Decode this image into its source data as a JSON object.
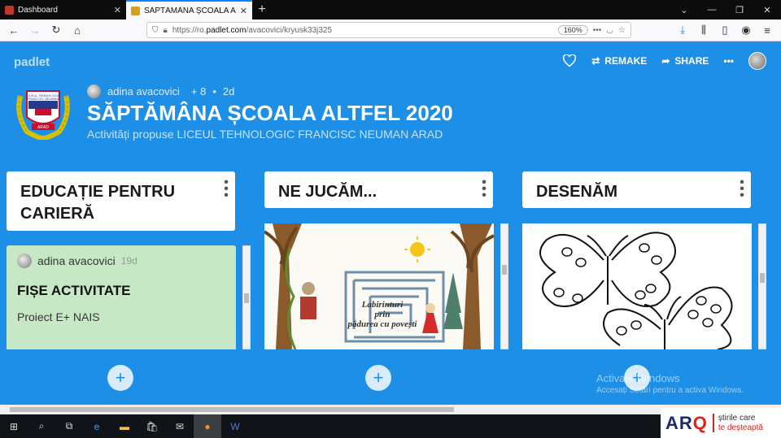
{
  "browser": {
    "tabs": [
      {
        "title": "Dashboard",
        "active": false
      },
      {
        "title": "SĂPTĂMÂNA ȘCOALA ALTFEL",
        "active": true
      }
    ],
    "url_prefix": "https://ro.",
    "url_host": "padlet.com",
    "url_path": "/avacovici/kryusk33j325",
    "zoom": "160%"
  },
  "header": {
    "logo": "padlet",
    "remake": "REMAKE",
    "share": "SHARE",
    "more": "•••"
  },
  "board": {
    "author": "adina avacovici",
    "contributors": "+ 8",
    "dot": "•",
    "age": "2d",
    "title": "SĂPTĂMÂNA ȘCOALA ALTFEL 2020",
    "subtitle": "Activități propuse LICEUL TEHNOLOGIC FRANCISC NEUMAN ARAD",
    "badge_text_1": "LICEUL TEHNOLOGIC",
    "badge_text_2": "FRANCISC NEUMAN",
    "badge_text_3": "ARAD"
  },
  "columns": [
    {
      "title": "EDUCAȚIE PENTRU CARIERĂ"
    },
    {
      "title": "NE JUCĂM..."
    },
    {
      "title": "DESENĂM"
    }
  ],
  "post": {
    "author": "adina avacovici",
    "age": "19d",
    "heading": "FIȘE ACTIVITATE",
    "body": "Proiect E+ NAIS"
  },
  "maze_card": {
    "line1": "Labirinturi",
    "line2": "prin",
    "line3": "pădurea cu povești"
  },
  "watermark": {
    "title": "Activate Windows",
    "body": "Accesați Setări pentru a activa Windows."
  },
  "arq": {
    "logo_a": "AR",
    "logo_b": "Q",
    "tag1": "știrile care",
    "tag2": "te deșteaptă"
  },
  "colors": {
    "board_bg": "#1e8fe6",
    "post_bg": "#c7e8c5",
    "add_button": "#d8ecfb"
  }
}
